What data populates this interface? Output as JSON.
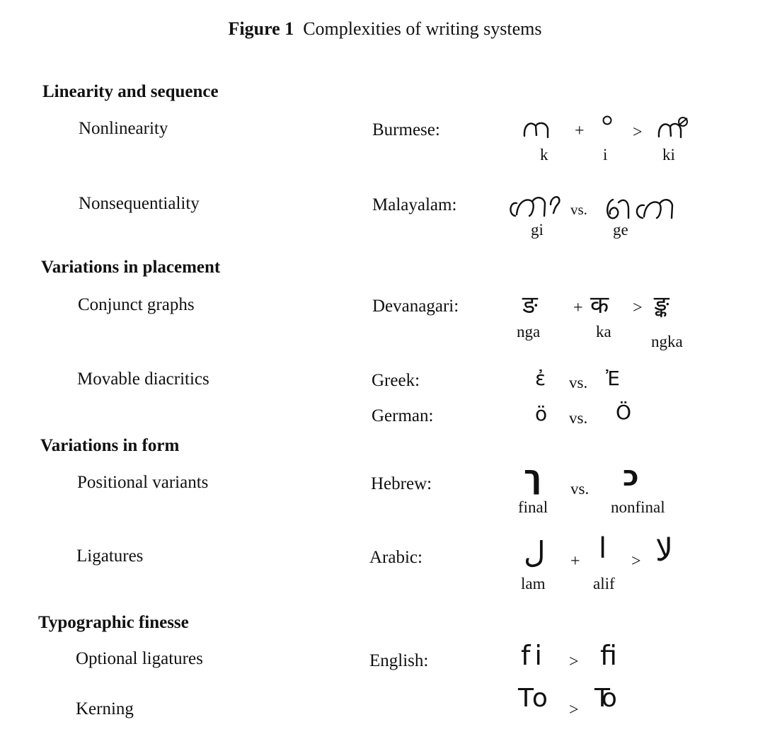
{
  "figure": {
    "number": "Figure 1",
    "title": "Complexities of writing systems"
  },
  "sections": [
    {
      "heading": "Linearity and sequence",
      "rows": [
        {
          "label": "Nonlinearity",
          "language": "Burmese:",
          "captions": [
            "k",
            "i",
            "ki"
          ]
        },
        {
          "label": "Nonsequentiality",
          "language": "Malayalam:",
          "captions": [
            "gi",
            "ge"
          ],
          "vs": "vs."
        }
      ]
    },
    {
      "heading": "Variations in placement",
      "rows": [
        {
          "label": "Conjunct graphs",
          "language": "Devanagari:",
          "glyphs": [
            "ङ",
            "क",
            "ङ्क"
          ],
          "captions": [
            "nga",
            "ka",
            "ngka"
          ]
        },
        {
          "label": "Movable diacritics",
          "language": "Greek:",
          "glyphs": [
            "ἐ",
            "Ἐ"
          ],
          "vs": "vs."
        },
        {
          "language": "German:",
          "glyphs": [
            "ö",
            "Ö"
          ],
          "vs": "vs."
        }
      ]
    },
    {
      "heading": "Variations in form",
      "rows": [
        {
          "label": "Positional variants",
          "language": "Hebrew:",
          "glyphs": [
            "ך",
            "כ"
          ],
          "captions": [
            "final",
            "nonfinal"
          ],
          "vs": "vs."
        },
        {
          "label": "Ligatures",
          "language": "Arabic:",
          "glyphs": [
            "ل",
            "ا",
            "لا"
          ],
          "captions": [
            "lam",
            "alif"
          ]
        }
      ]
    },
    {
      "heading": "Typographic finesse",
      "rows": [
        {
          "label": "Optional ligatures",
          "language": "English:",
          "glyphs": [
            "fi",
            "ﬁ"
          ]
        },
        {
          "label": "Kerning",
          "glyphs": [
            "To",
            "To"
          ]
        }
      ]
    }
  ],
  "symbols": {
    "plus": "+",
    "yields": ">"
  }
}
